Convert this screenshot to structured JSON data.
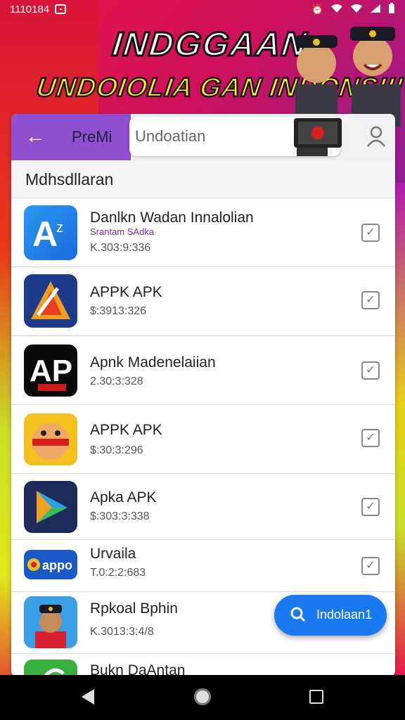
{
  "statusbar": {
    "time": "1110184",
    "icons": [
      "alarm-icon",
      "wifi-icon",
      "signal-icon",
      "battery-icon"
    ]
  },
  "banner": {
    "title": "INDGGAAN",
    "subtitle": "UNDOIOLIA GAN INDONSII!"
  },
  "topbar": {
    "title": "PreMi",
    "search_value": "Undoatian"
  },
  "section": {
    "header": "Mdhsdllaran"
  },
  "apps": [
    {
      "name": "Danlkn Wadan Innalolian",
      "sub": "Srantam SAdka",
      "num": "K.303:9:336",
      "icon": "az-app-icon"
    },
    {
      "name": "APPK APK",
      "sub": "",
      "num": "$:3913:326",
      "icon": "triangle-app-icon"
    },
    {
      "name": "Apnk Madenelaiian",
      "sub": "",
      "num": "2.30:3:328",
      "icon": "ap-logo-icon"
    },
    {
      "name": "APPK APK",
      "sub": "",
      "num": "$:30:3:296",
      "icon": "face-app-icon"
    },
    {
      "name": "Apka APK",
      "sub": "",
      "num": "$:303:3:338",
      "icon": "play-app-icon"
    },
    {
      "name": "Urvaila",
      "sub": "",
      "num": "T.0:2:2:683",
      "icon": "appo-icon"
    },
    {
      "name": "Rpkoal Bphin",
      "sub": "",
      "num": "K.3013:3:4/8",
      "icon": "avatar-app-icon"
    },
    {
      "name": "Bukn DaAntan",
      "sub": "",
      "num": "",
      "icon": "leaf-app-icon"
    }
  ],
  "fab": {
    "label": "Indolaan1"
  },
  "colors": {
    "accent": "#8f4fd0",
    "fab": "#1a78f0"
  }
}
